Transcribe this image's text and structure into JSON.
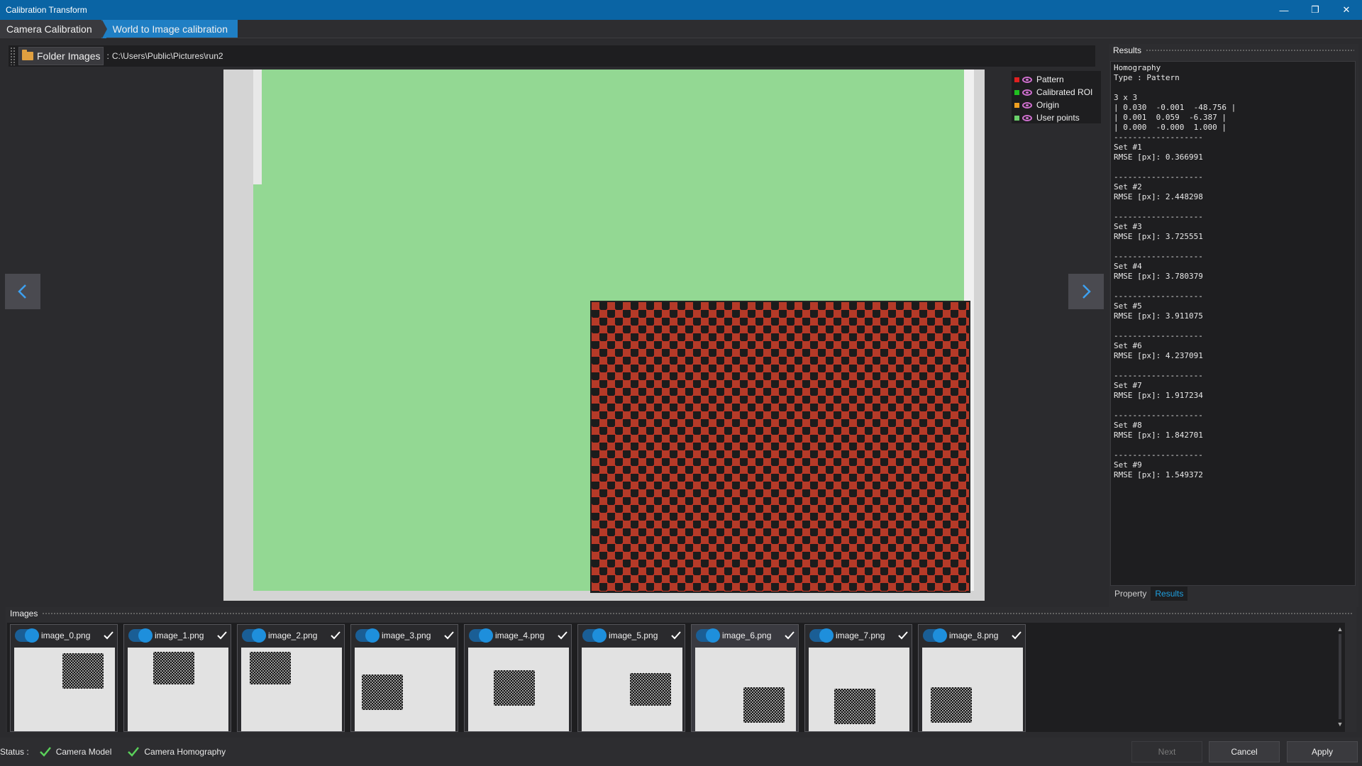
{
  "window": {
    "title": "Calibration Transform"
  },
  "tabs": [
    {
      "label": "Camera Calibration"
    },
    {
      "label": "World to Image calibration"
    }
  ],
  "path_bar": {
    "folder_label": "Folder Images",
    "separator": ":",
    "path": "C:\\Users\\Public\\Pictures\\run2"
  },
  "legend": [
    {
      "label": "Pattern",
      "color": "#e02020",
      "icon": "eye-icon"
    },
    {
      "label": "Calibrated ROI",
      "color": "#20c020",
      "icon": "eye-icon"
    },
    {
      "label": "Origin",
      "color": "#f0a020",
      "icon": "eye-icon"
    },
    {
      "label": "User points",
      "color": "#6ad06a",
      "icon": "eye-icon"
    }
  ],
  "results_panel": {
    "title": "Results",
    "text": "Homography\nType : Pattern\n\n3 x 3\n| 0.030  -0.001  -48.756 |\n| 0.001  0.059  -6.387 |\n| 0.000  -0.000  1.000 |\n-------------------\nSet #1\nRMSE [px]: 0.366991\n\n-------------------\nSet #2\nRMSE [px]: 2.448298\n\n-------------------\nSet #3\nRMSE [px]: 3.725551\n\n-------------------\nSet #4\nRMSE [px]: 3.780379\n\n-------------------\nSet #5\nRMSE [px]: 3.911075\n\n-------------------\nSet #6\nRMSE [px]: 4.237091\n\n-------------------\nSet #7\nRMSE [px]: 1.917234\n\n-------------------\nSet #8\nRMSE [px]: 1.842701\n\n-------------------\nSet #9\nRMSE [px]: 1.549372",
    "tabs": [
      {
        "label": "Property"
      },
      {
        "label": "Results"
      }
    ]
  },
  "images_panel": {
    "title": "Images",
    "items": [
      {
        "name": "image_0.png",
        "enabled": true,
        "checked": true,
        "selected": false
      },
      {
        "name": "image_1.png",
        "enabled": true,
        "checked": true,
        "selected": false
      },
      {
        "name": "image_2.png",
        "enabled": true,
        "checked": true,
        "selected": false
      },
      {
        "name": "image_3.png",
        "enabled": true,
        "checked": true,
        "selected": false
      },
      {
        "name": "image_4.png",
        "enabled": true,
        "checked": true,
        "selected": false
      },
      {
        "name": "image_5.png",
        "enabled": true,
        "checked": true,
        "selected": false
      },
      {
        "name": "image_6.png",
        "enabled": true,
        "checked": true,
        "selected": true
      },
      {
        "name": "image_7.png",
        "enabled": true,
        "checked": true,
        "selected": false
      },
      {
        "name": "image_8.png",
        "enabled": true,
        "checked": true,
        "selected": false
      }
    ]
  },
  "status": {
    "label": "Status :",
    "items": [
      {
        "label": "Camera Model",
        "ok": true
      },
      {
        "label": "Camera Homography",
        "ok": true
      }
    ]
  },
  "buttons": {
    "next": "Next",
    "cancel": "Cancel",
    "apply": "Apply"
  },
  "colors": {
    "accent": "#1f7fc4",
    "titlebar": "#0a64a4",
    "roi": "#93d893",
    "check": "#5ad05a"
  }
}
